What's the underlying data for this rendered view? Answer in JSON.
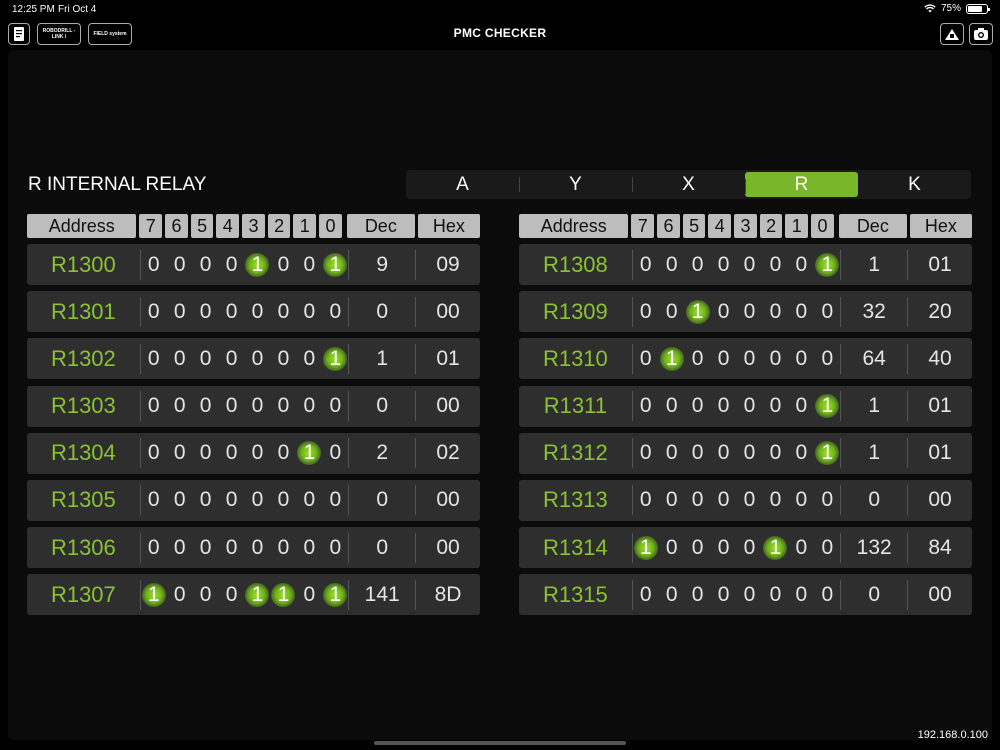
{
  "status": {
    "time": "12:25 PM",
    "date": "Fri Oct 4",
    "battery": "75%",
    "battery_level": 0.75
  },
  "toolbar": {
    "title": "PMC CHECKER",
    "btn_roboddrill": "ROBODRILL -LINK i",
    "btn_field": "FIELD system"
  },
  "section_title": "R INTERNAL RELAY",
  "tabs": [
    "A",
    "Y",
    "X",
    "R",
    "K"
  ],
  "active_tab": "R",
  "headers": {
    "address": "Address",
    "bits": [
      "7",
      "6",
      "5",
      "4",
      "3",
      "2",
      "1",
      "0"
    ],
    "dec": "Dec",
    "hex": "Hex"
  },
  "left_rows": [
    {
      "address": "R1300",
      "bits": [
        "0",
        "0",
        "0",
        "0",
        "1",
        "0",
        "0",
        "1"
      ],
      "dec": "9",
      "hex": "09"
    },
    {
      "address": "R1301",
      "bits": [
        "0",
        "0",
        "0",
        "0",
        "0",
        "0",
        "0",
        "0"
      ],
      "dec": "0",
      "hex": "00"
    },
    {
      "address": "R1302",
      "bits": [
        "0",
        "0",
        "0",
        "0",
        "0",
        "0",
        "0",
        "1"
      ],
      "dec": "1",
      "hex": "01"
    },
    {
      "address": "R1303",
      "bits": [
        "0",
        "0",
        "0",
        "0",
        "0",
        "0",
        "0",
        "0"
      ],
      "dec": "0",
      "hex": "00"
    },
    {
      "address": "R1304",
      "bits": [
        "0",
        "0",
        "0",
        "0",
        "0",
        "0",
        "1",
        "0"
      ],
      "dec": "2",
      "hex": "02"
    },
    {
      "address": "R1305",
      "bits": [
        "0",
        "0",
        "0",
        "0",
        "0",
        "0",
        "0",
        "0"
      ],
      "dec": "0",
      "hex": "00"
    },
    {
      "address": "R1306",
      "bits": [
        "0",
        "0",
        "0",
        "0",
        "0",
        "0",
        "0",
        "0"
      ],
      "dec": "0",
      "hex": "00"
    },
    {
      "address": "R1307",
      "bits": [
        "1",
        "0",
        "0",
        "0",
        "1",
        "1",
        "0",
        "1"
      ],
      "dec": "141",
      "hex": "8D"
    }
  ],
  "right_rows": [
    {
      "address": "R1308",
      "bits": [
        "0",
        "0",
        "0",
        "0",
        "0",
        "0",
        "0",
        "1"
      ],
      "dec": "1",
      "hex": "01"
    },
    {
      "address": "R1309",
      "bits": [
        "0",
        "0",
        "1",
        "0",
        "0",
        "0",
        "0",
        "0"
      ],
      "dec": "32",
      "hex": "20"
    },
    {
      "address": "R1310",
      "bits": [
        "0",
        "1",
        "0",
        "0",
        "0",
        "0",
        "0",
        "0"
      ],
      "dec": "64",
      "hex": "40"
    },
    {
      "address": "R1311",
      "bits": [
        "0",
        "0",
        "0",
        "0",
        "0",
        "0",
        "0",
        "1"
      ],
      "dec": "1",
      "hex": "01"
    },
    {
      "address": "R1312",
      "bits": [
        "0",
        "0",
        "0",
        "0",
        "0",
        "0",
        "0",
        "1"
      ],
      "dec": "1",
      "hex": "01"
    },
    {
      "address": "R1313",
      "bits": [
        "0",
        "0",
        "0",
        "0",
        "0",
        "0",
        "0",
        "0"
      ],
      "dec": "0",
      "hex": "00"
    },
    {
      "address": "R1314",
      "bits": [
        "1",
        "0",
        "0",
        "0",
        "0",
        "1",
        "0",
        "0"
      ],
      "dec": "132",
      "hex": "84"
    },
    {
      "address": "R1315",
      "bits": [
        "0",
        "0",
        "0",
        "0",
        "0",
        "0",
        "0",
        "0"
      ],
      "dec": "0",
      "hex": "00"
    }
  ],
  "ip_address": "192.168.0.100",
  "icons": {
    "manual": "document-icon",
    "machine": "machine-icon",
    "camera": "camera-icon"
  }
}
